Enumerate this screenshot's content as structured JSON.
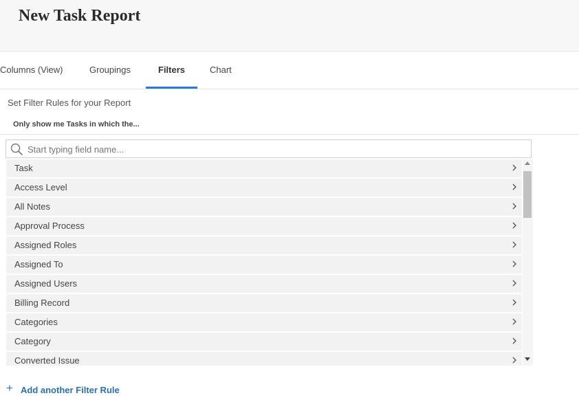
{
  "header": {
    "title": "New Task Report"
  },
  "tabs": [
    {
      "label": "Columns (View)",
      "active": false
    },
    {
      "label": "Groupings",
      "active": false
    },
    {
      "label": "Filters",
      "active": true
    },
    {
      "label": "Chart",
      "active": false
    }
  ],
  "filters": {
    "subtitle": "Set Filter Rules for your Report",
    "rule_caption": "Only show me Tasks in which the...",
    "search": {
      "value": "",
      "placeholder": "Start typing field name..."
    },
    "fields": [
      "Task",
      "Access Level",
      "All Notes",
      "Approval Process",
      "Assigned Roles",
      "Assigned To",
      "Assigned Users",
      "Billing Record",
      "Categories",
      "Category",
      "Converted Issue"
    ],
    "add_rule_label": "Add another Filter Rule"
  },
  "colors": {
    "accent": "#2a7bd6",
    "link": "#2a6fb8",
    "row_background": "#f2f2f2"
  },
  "icons": {
    "search": "search-icon",
    "row_chevron": "chevron-right-icon",
    "add": "plus-icon"
  }
}
